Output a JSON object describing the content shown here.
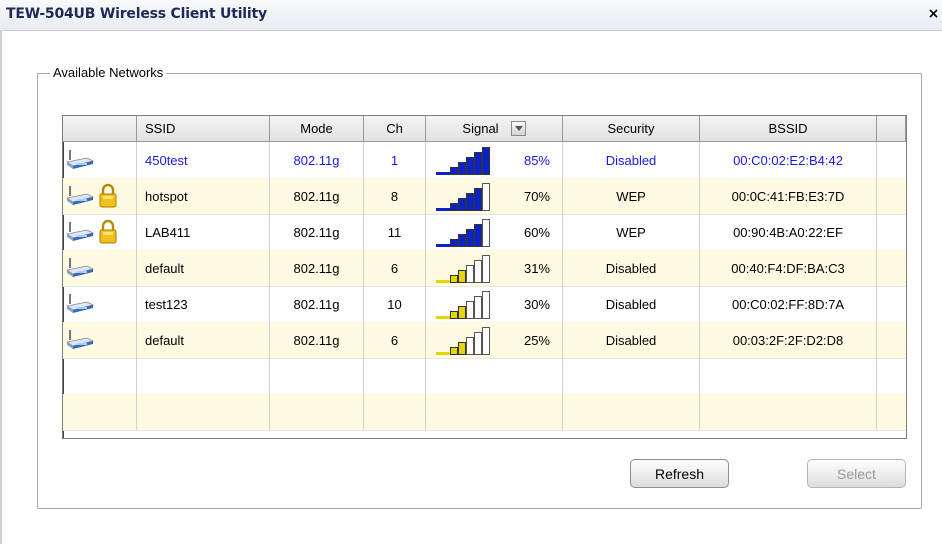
{
  "window": {
    "title": "TEW-504UB Wireless Client Utility",
    "close_glyph": "×"
  },
  "group": {
    "label": "Available Networks"
  },
  "table": {
    "columns": [
      "",
      "SSID",
      "Mode",
      "Ch",
      "Signal",
      "Security",
      "BSSID",
      ""
    ],
    "rows": [
      {
        "ssid": "450test",
        "mode": "802.11g",
        "ch": "1",
        "signal_bars": 5,
        "signal": "85%",
        "security": "Disabled",
        "bssid": "00:C0:02:E2:B4:42",
        "locked": false,
        "selected": true
      },
      {
        "ssid": "hotspot",
        "mode": "802.11g",
        "ch": "8",
        "signal_bars": 4,
        "signal": "70%",
        "security": "WEP",
        "bssid": "00:0C:41:FB:E3:7D",
        "locked": true,
        "selected": false
      },
      {
        "ssid": "LAB411",
        "mode": "802.11g",
        "ch": "11",
        "signal_bars": 4,
        "signal": "60%",
        "security": "WEP",
        "bssid": "00:90:4B:A0:22:EF",
        "locked": true,
        "selected": false
      },
      {
        "ssid": "default",
        "mode": "802.11g",
        "ch": "6",
        "signal_bars": 2,
        "signal": "31%",
        "security": "Disabled",
        "bssid": "00:40:F4:DF:BA:C3",
        "locked": false,
        "selected": false
      },
      {
        "ssid": "test123",
        "mode": "802.11g",
        "ch": "10",
        "signal_bars": 2,
        "signal": "30%",
        "security": "Disabled",
        "bssid": "00:C0:02:FF:8D:7A",
        "locked": false,
        "selected": false
      },
      {
        "ssid": "default",
        "mode": "802.11g",
        "ch": "6",
        "signal_bars": 2,
        "signal": "25%",
        "security": "Disabled",
        "bssid": "00:03:2F:2F:D2:D8",
        "locked": false,
        "selected": false
      }
    ]
  },
  "buttons": {
    "refresh": "Refresh",
    "select": "Select"
  },
  "colors": {
    "selected_text": "#1a1ae6",
    "alt_row": "#fffbe2",
    "strong_signal": "#0a22c8",
    "weak_signal": "#e8d400"
  }
}
